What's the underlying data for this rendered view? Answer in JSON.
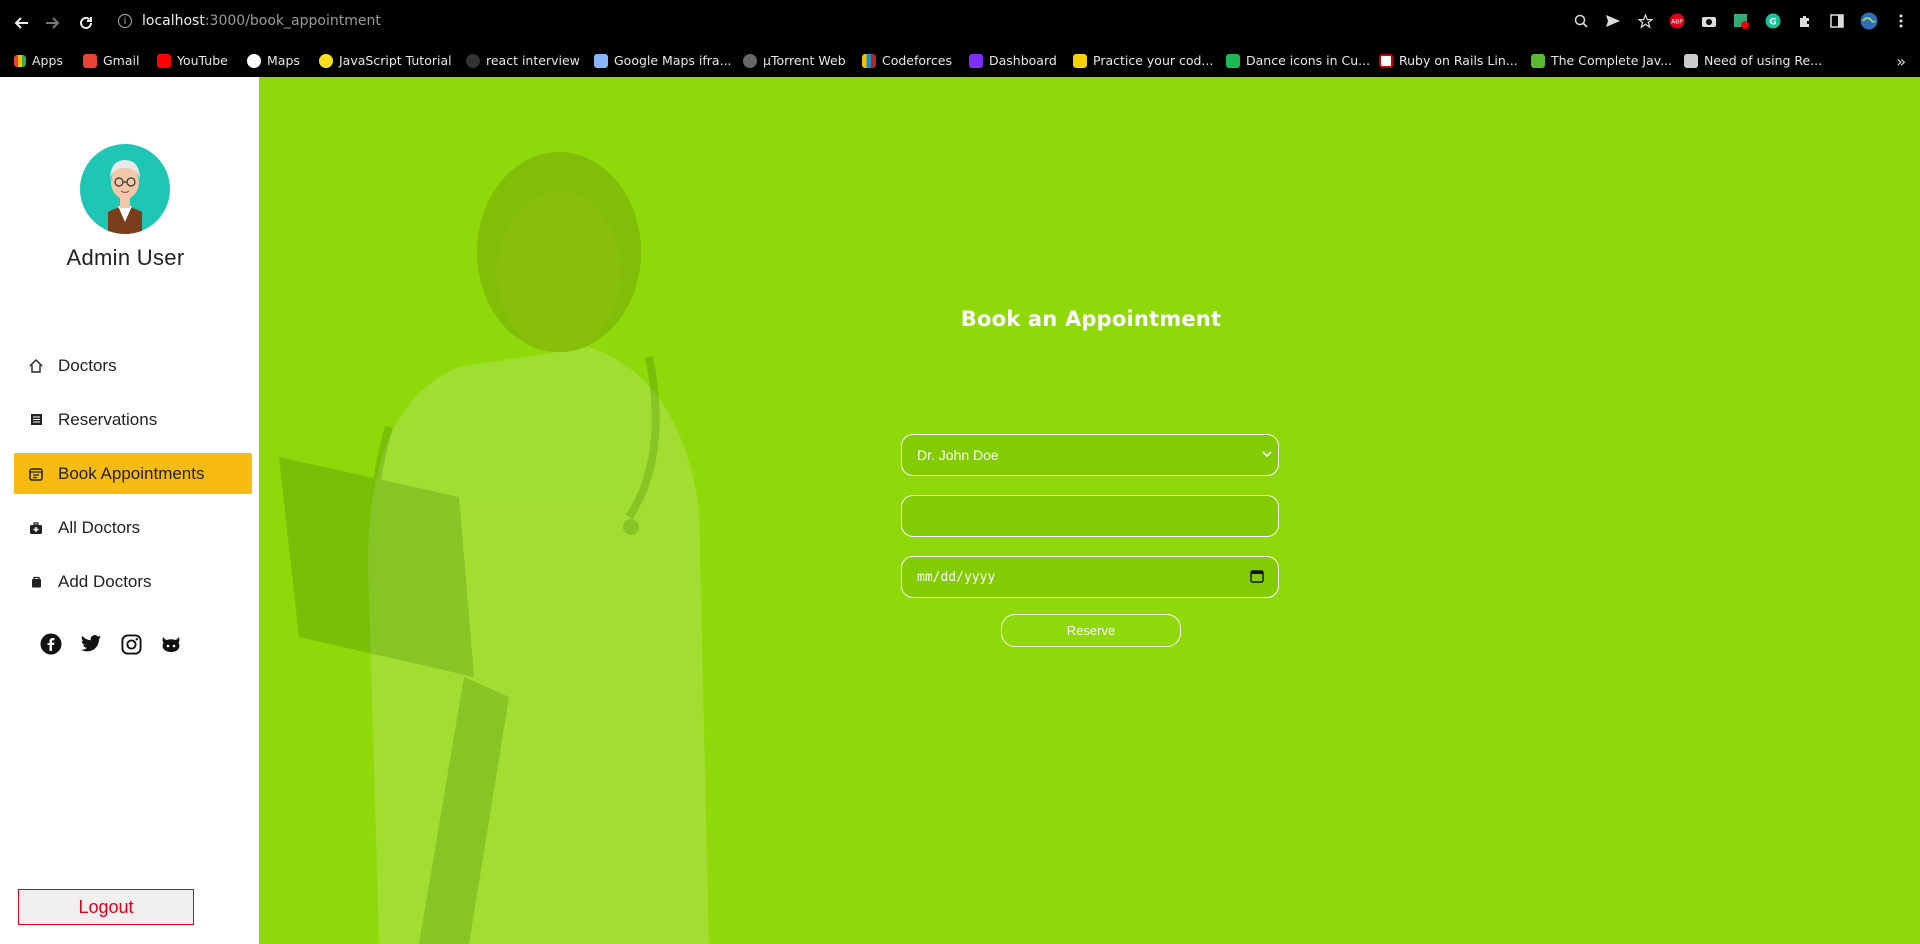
{
  "browser": {
    "url_host": "localhost",
    "url_path": ":3000/book_appointment",
    "bookmarks": [
      {
        "label": "Apps",
        "color": "#e8eaed"
      },
      {
        "label": "Gmail",
        "color": "#ea4335"
      },
      {
        "label": "YouTube",
        "color": "#ff0000"
      },
      {
        "label": "Maps",
        "color": "#34a853"
      },
      {
        "label": "JavaScript Tutorial",
        "color": "#f7df1e"
      },
      {
        "label": "react interview",
        "color": "#333333"
      },
      {
        "label": "Google Maps ifra...",
        "color": "#8ab4f8"
      },
      {
        "label": "µTorrent Web",
        "color": "#666666"
      },
      {
        "label": "Codeforces",
        "color": "#1f8acb"
      },
      {
        "label": "Dashboard",
        "color": "#7b2ff7"
      },
      {
        "label": "Practice your cod...",
        "color": "#f5d100"
      },
      {
        "label": "Dance icons in Cu...",
        "color": "#1db954"
      },
      {
        "label": "Ruby on Rails Lin...",
        "color": "#cc0000"
      },
      {
        "label": "The Complete Jav...",
        "color": "#5fb832"
      },
      {
        "label": "Need of using Re...",
        "color": "#cccccc"
      }
    ]
  },
  "sidebar": {
    "user_name": "Admin User",
    "menu": [
      {
        "label": "Doctors",
        "icon": "home-icon",
        "active": false
      },
      {
        "label": "Reservations",
        "icon": "list-icon",
        "active": false
      },
      {
        "label": "Book Appointments",
        "icon": "calendar-icon",
        "active": true
      },
      {
        "label": "All Doctors",
        "icon": "medkit-icon",
        "active": false
      },
      {
        "label": "Add Doctors",
        "icon": "bag-icon",
        "active": false
      }
    ],
    "logout_label": "Logout"
  },
  "form": {
    "title": "Book an Appointment",
    "doctor_selected": "Dr. John Doe",
    "city_value": "",
    "date_placeholder": "mm/dd/yyyy",
    "reserve_label": "Reserve"
  },
  "colors": {
    "main_bg": "#8fd80a",
    "active_menu": "#f8bb14",
    "logout": "#e0001b",
    "avatar_bg": "#1fc6b4"
  }
}
